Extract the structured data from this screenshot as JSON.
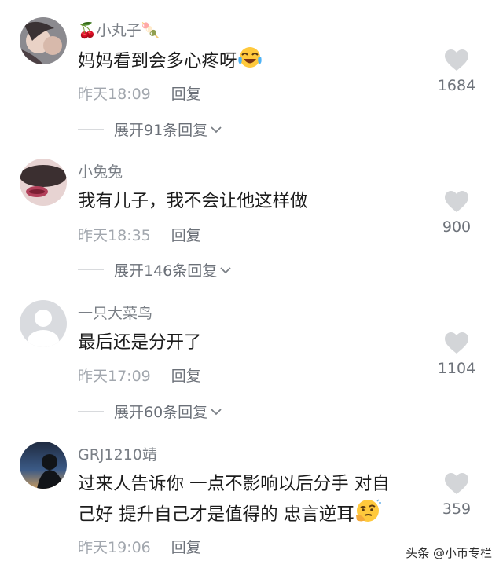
{
  "comments": [
    {
      "username": "🍒小丸子🍡",
      "text": "妈妈看到会多心疼呀",
      "time": "昨天18:09",
      "reply": "回复",
      "likes": "1684",
      "expand": "展开91条回复",
      "text_emoji": "laughing-crying-emoji"
    },
    {
      "username": "小兔兔",
      "text": "我有儿子，我不会让他这样做",
      "time": "昨天18:35",
      "reply": "回复",
      "likes": "900",
      "expand": "展开146条回复"
    },
    {
      "username": "一只大菜鸟",
      "text": "最后还是分开了",
      "time": "昨天17:09",
      "reply": "回复",
      "likes": "1104",
      "expand": "展开60条回复"
    },
    {
      "username": "GRJ1210靖",
      "text_line1": "过来人告诉你  一点不影响以后分手  对自",
      "text_line2": "己好  提升自己才是值得的  忠言逆耳",
      "time": "昨天19:06",
      "reply": "回复",
      "likes": "359",
      "text_emoji": "thinking-emoji"
    }
  ],
  "watermark": "头条 @小币专栏",
  "colors": {
    "username": "#7a7f86",
    "meta": "#a2a7ae",
    "heart": "#d3d5d8",
    "background": "#ffffff"
  }
}
